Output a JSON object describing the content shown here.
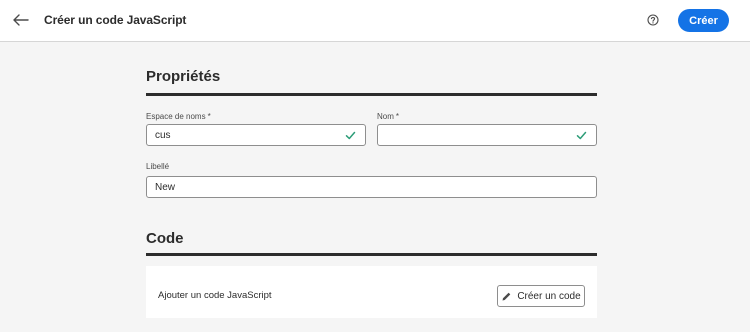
{
  "header": {
    "title": "Créer un code JavaScript",
    "back_icon": "arrow-left-icon",
    "help_icon": "help-circle-icon",
    "create_label": "Créer",
    "accent_color": "#1473e6"
  },
  "properties": {
    "title": "Propriétés",
    "namespace": {
      "label": "Espace de noms",
      "required_mark": "*",
      "value": "cus",
      "status_icon": "checkmark-icon"
    },
    "name": {
      "label": "Nom",
      "required_mark": "*",
      "value": "",
      "status_icon": "checkmark-icon"
    },
    "libelle": {
      "label": "Libellé",
      "value": "New"
    }
  },
  "code": {
    "title": "Code",
    "add_label": "Ajouter un code JavaScript",
    "button_label": "Créer un code",
    "button_icon": "pencil-icon",
    "valid_color": "#2d9d78"
  }
}
